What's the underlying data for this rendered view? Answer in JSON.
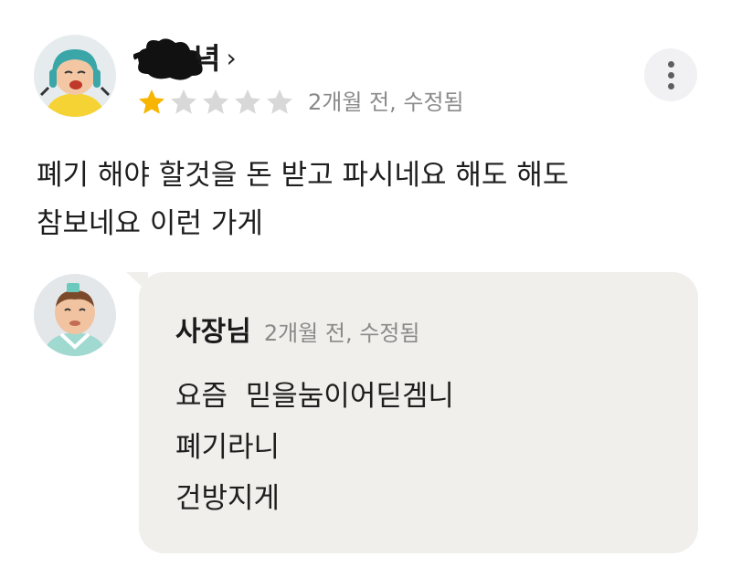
{
  "review": {
    "reviewer_name_visible": "녁",
    "rating": 1,
    "rating_max": 5,
    "meta": "2개월 전, 수정됨",
    "text_line1": "폐기 해야 할것을 돈 받고 파시네요 해도 해도",
    "text_line2": "참보네요 이런 가게",
    "chevron": "›"
  },
  "reply": {
    "author": "사장님",
    "meta": "2개월 전, 수정됨",
    "lines": [
      "요즘  믿을눔이어딛겜니",
      "폐기라니",
      "건방지게"
    ]
  },
  "icons": {
    "more": "more-vertical-icon",
    "star_filled": "star-filled-icon",
    "star_empty": "star-empty-icon"
  },
  "colors": {
    "star_filled": "#f7b500",
    "star_empty": "#d8d8d8",
    "meta_text": "#8a8a8a",
    "reply_bg": "#f0efec"
  }
}
